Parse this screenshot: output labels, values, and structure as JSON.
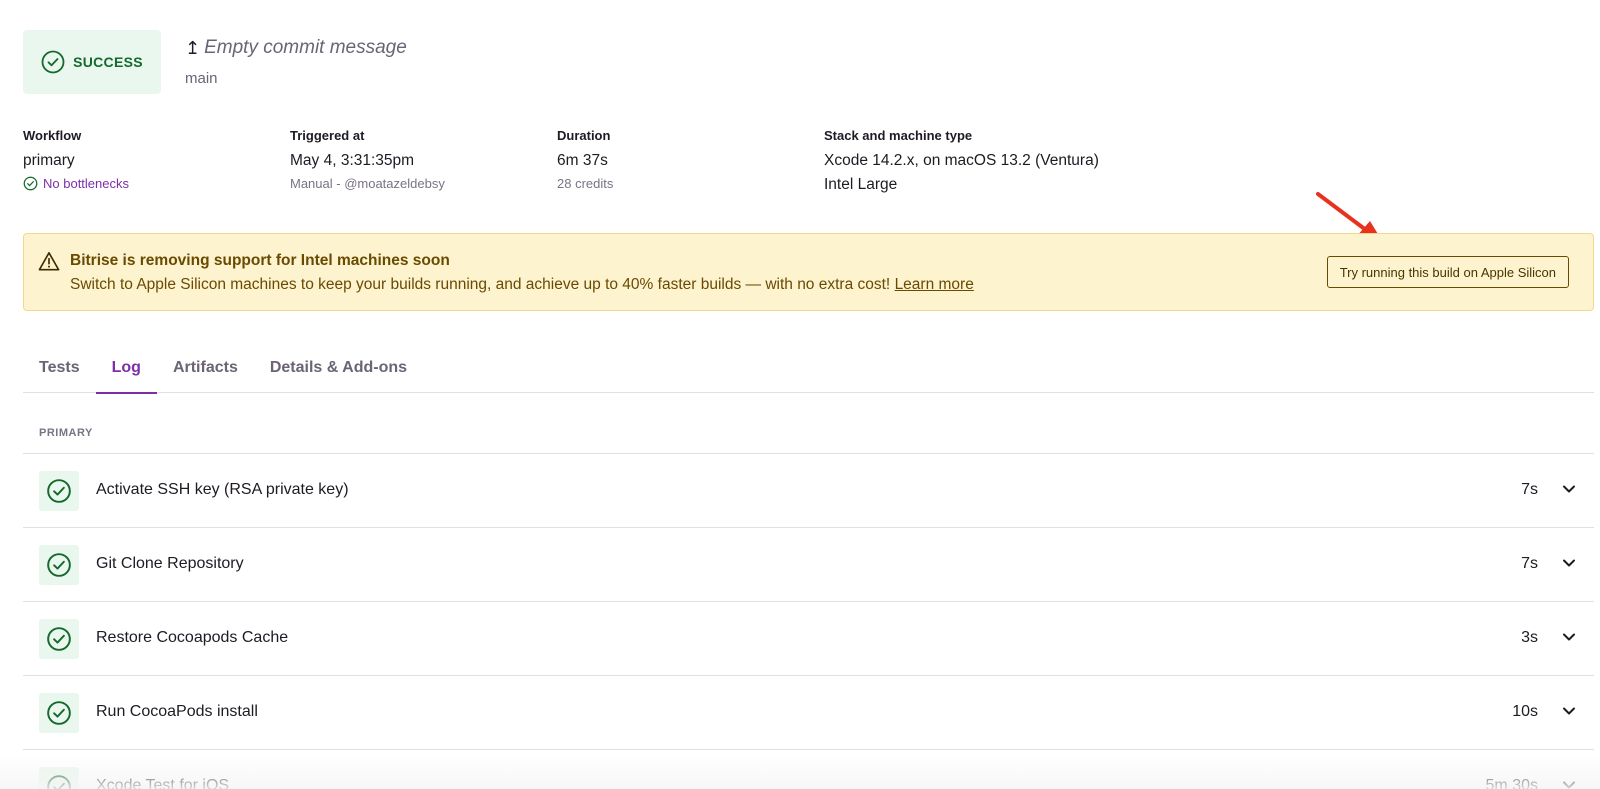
{
  "build": {
    "status": "SUCCESS",
    "commit_message": "Empty commit message",
    "branch": "main"
  },
  "meta": {
    "workflow": {
      "label": "Workflow",
      "value": "primary",
      "sub": "No bottlenecks"
    },
    "triggered": {
      "label": "Triggered at",
      "value": "May 4, 3:31:35pm",
      "sub": "Manual - @moatazeldebsy"
    },
    "duration": {
      "label": "Duration",
      "value": "6m 37s",
      "sub": "28 credits"
    },
    "stack": {
      "label": "Stack and machine type",
      "value": "Xcode 14.2.x, on macOS 13.2 (Ventura)",
      "machine": "Intel Large"
    }
  },
  "banner": {
    "title": "Bitrise is removing support for Intel machines soon",
    "text": "Switch to Apple Silicon machines to keep your builds running, and achieve up to 40% faster builds — with no extra cost!",
    "link": "Learn more",
    "button": "Try running this build on Apple Silicon"
  },
  "tabs": [
    {
      "label": "Tests"
    },
    {
      "label": "Log"
    },
    {
      "label": "Artifacts"
    },
    {
      "label": "Details & Add-ons"
    }
  ],
  "active_tab": "Log",
  "section": "PRIMARY",
  "steps": [
    {
      "name": "Activate SSH key (RSA private key)",
      "duration": "7s"
    },
    {
      "name": "Git Clone Repository",
      "duration": "7s"
    },
    {
      "name": "Restore Cocoapods Cache",
      "duration": "3s"
    },
    {
      "name": "Run CocoaPods install",
      "duration": "10s"
    },
    {
      "name": "Xcode Test for iOS",
      "duration": "5m 30s"
    }
  ],
  "colors": {
    "success": "#14692c",
    "success_bg": "#eaf7ee",
    "accent": "#7c2fa8",
    "banner_bg": "#fdf4cf",
    "banner_text": "#6a4a00",
    "annotation_arrow": "#e8321e"
  }
}
